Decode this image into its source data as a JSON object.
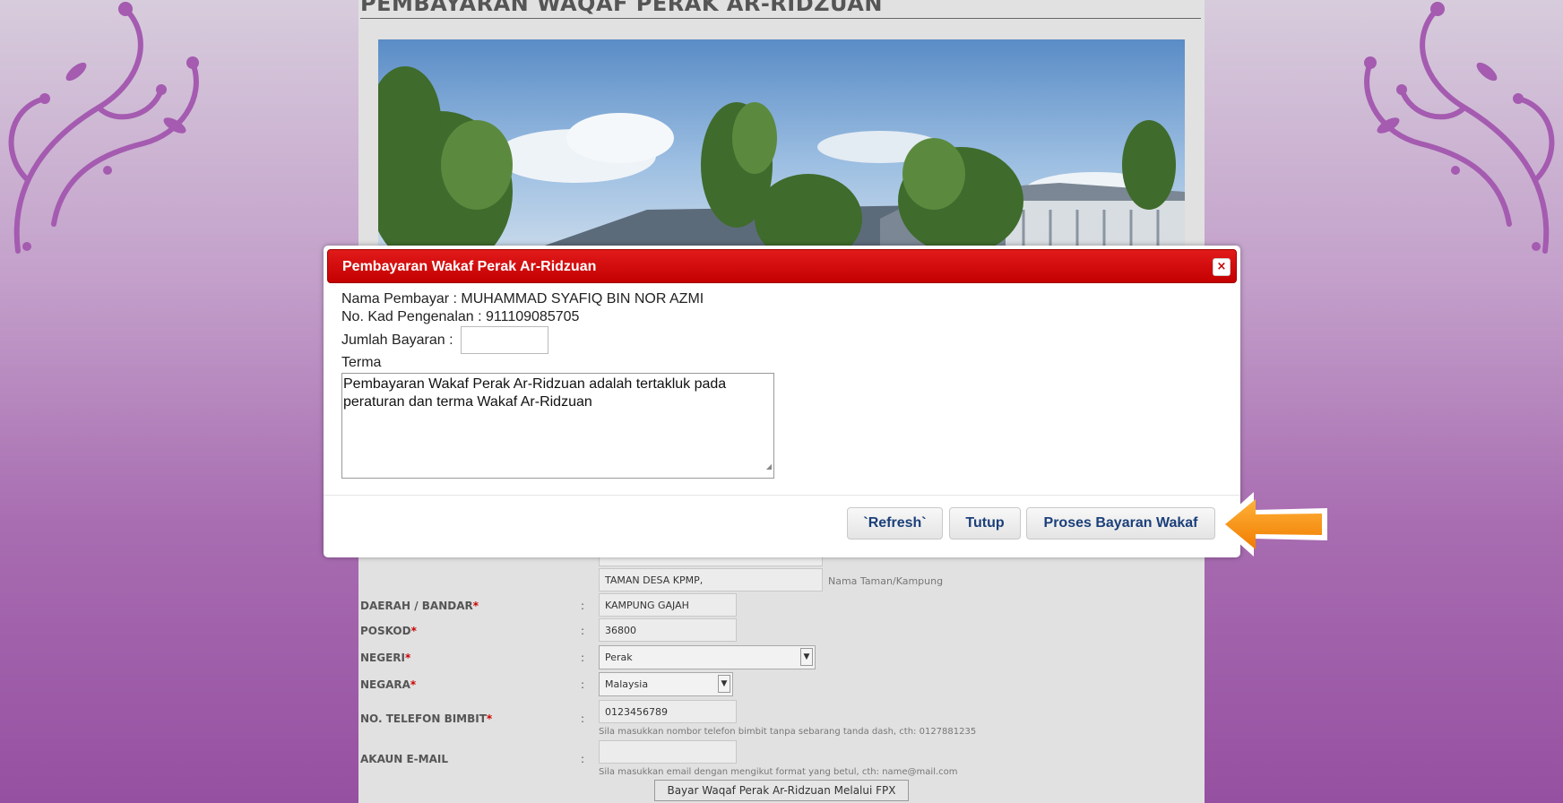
{
  "page": {
    "title": "PEMBAYARAN WAQAF PERAK AR-RIDZUAN"
  },
  "form": {
    "address_line_partial": "",
    "address_line_partial_hint": "",
    "taman": "TAMAN DESA KPMP,",
    "taman_hint": "Nama Taman/Kampung",
    "daerah_label": "DAERAH / BANDAR",
    "daerah_value": "KAMPUNG GAJAH",
    "poskod_label": "POSKOD",
    "poskod_value": "36800",
    "negeri_label": "NEGERI",
    "negeri_value": "Perak",
    "negara_label": "NEGARA",
    "negara_value": "Malaysia",
    "telefon_label": "NO. TELEFON BIMBIT",
    "telefon_value": "0123456789",
    "telefon_hint": "Sila masukkan nombor telefon bimbit tanpa sebarang tanda dash, cth: 0127881235",
    "email_label": "AKAUN E-MAIL",
    "email_value": "",
    "email_hint": "Sila masukkan email dengan mengikut format yang betul, cth: name@mail.com",
    "required_mark": "*",
    "colon": ":",
    "fpx_button": "Bayar Waqaf Perak Ar-Ridzuan Melalui FPX"
  },
  "modal": {
    "title": "Pembayaran Wakaf Perak Ar-Ridzuan",
    "close_glyph": "×",
    "nama_pembayar": "Nama Pembayar : MUHAMMAD SYAFIQ BIN NOR AZMI",
    "no_kad": "No. Kad Pengenalan : 911109085705",
    "jumlah_label": "Jumlah Bayaran :",
    "jumlah_value": "",
    "terma_label": "Terma",
    "terma_text": "Pembayaran Wakaf Perak Ar-Ridzuan adalah tertakluk pada peraturan dan terma Wakaf Ar-Ridzuan",
    "buttons": {
      "refresh": "`Refresh`",
      "tutup": "Tutup",
      "proses": "Proses Bayaran Wakaf"
    }
  },
  "colors": {
    "modal_header": "#c40000",
    "button_text": "#1b3f7a",
    "arrow": "#f7941d",
    "required": "#cc0000"
  }
}
